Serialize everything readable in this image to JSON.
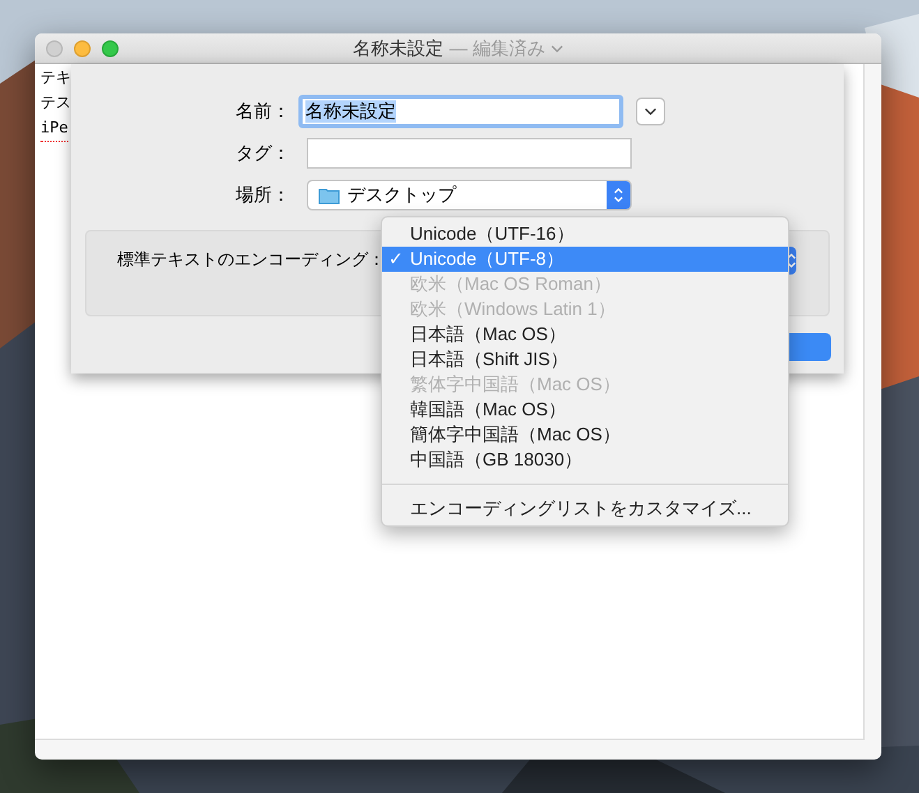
{
  "window": {
    "title": "名称未設定",
    "subtitle": "— 編集済み"
  },
  "document": {
    "lines": [
      "テキ",
      "テス",
      "iPe"
    ]
  },
  "sheet": {
    "name_label": "名前：",
    "name_value": "名称未設定",
    "tags_label": "タグ：",
    "location_label": "場所：",
    "location_value": "デスクトップ",
    "encoding_label": "標準テキストのエンコーディング："
  },
  "menu": [
    {
      "kind": "item",
      "label": "Unicode（UTF-16）",
      "selected": false,
      "disabled": false
    },
    {
      "kind": "item",
      "label": "Unicode（UTF-8）",
      "selected": true,
      "disabled": false
    },
    {
      "kind": "item",
      "label": "欧米（Mac OS Roman）",
      "selected": false,
      "disabled": true
    },
    {
      "kind": "item",
      "label": "欧米（Windows Latin 1）",
      "selected": false,
      "disabled": true
    },
    {
      "kind": "item",
      "label": "日本語（Mac OS）",
      "selected": false,
      "disabled": false
    },
    {
      "kind": "item",
      "label": "日本語（Shift JIS）",
      "selected": false,
      "disabled": false
    },
    {
      "kind": "item",
      "label": "繁体字中国語（Mac OS）",
      "selected": false,
      "disabled": true
    },
    {
      "kind": "item",
      "label": "韓国語（Mac OS）",
      "selected": false,
      "disabled": false
    },
    {
      "kind": "item",
      "label": "簡体字中国語（Mac OS）",
      "selected": false,
      "disabled": false
    },
    {
      "kind": "item",
      "label": "中国語（GB 18030）",
      "selected": false,
      "disabled": false
    },
    {
      "kind": "separator"
    },
    {
      "kind": "item",
      "label": "エンコーディングリストをカスタマイズ...",
      "selected": false,
      "disabled": false
    }
  ],
  "check_mark": "✓"
}
